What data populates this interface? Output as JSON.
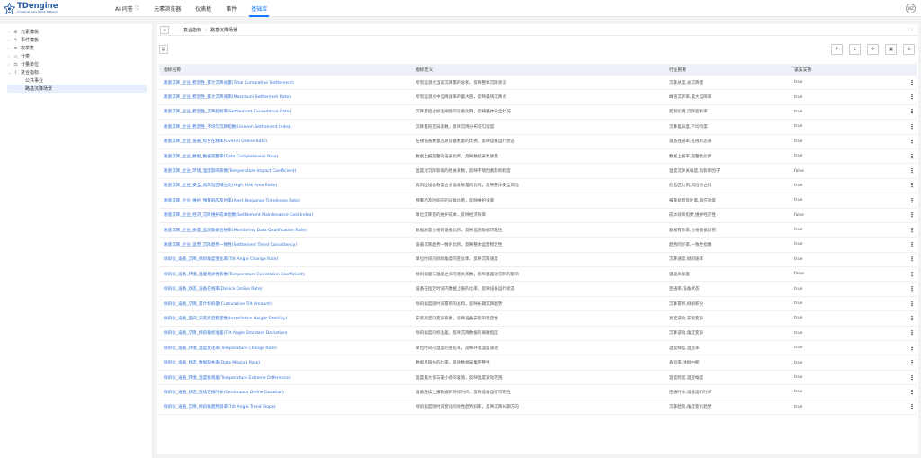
{
  "header": {
    "logo_name": "TDengine",
    "logo_tagline": "Industrial Data Mgmt Platform",
    "nav": [
      {
        "label": "AI 问答"
      },
      {
        "label": "元素浏览器"
      },
      {
        "label": "仪表板"
      },
      {
        "label": "事件"
      },
      {
        "label": "基础库"
      }
    ],
    "active_nav": "基础库",
    "avatar_initials": "WZ"
  },
  "sidebar": {
    "items": [
      {
        "label": "元素模板",
        "icon": "element-template-icon"
      },
      {
        "label": "事件模板",
        "icon": "event-template-icon"
      },
      {
        "label": "枚举集",
        "icon": "enum-icon"
      },
      {
        "label": "分类",
        "icon": "category-icon"
      },
      {
        "label": "计量单位",
        "icon": "unit-icon"
      },
      {
        "label": "复合指标",
        "icon": "composite-icon"
      }
    ],
    "children": [
      {
        "label": "公共事业"
      },
      {
        "label": "路基沉降场景"
      }
    ],
    "selected": "路基沉降场景"
  },
  "breadcrumb": {
    "parent": "复合指标",
    "current": "路基沉降场景"
  },
  "table": {
    "columns": [
      "指标名称",
      "指标定义",
      "行业别称",
      "该法支持"
    ],
    "rows": [
      [
        "路基沉降_企业_稳定性_累计沉降总量(Total Cumulative Settlement)",
        "所有监测点当前沉降量的总和，反映整体沉降状况",
        "沉降总量,总沉降量",
        "true"
      ],
      [
        "路基沉降_企业_稳定性_最大沉降速率(Maximum Settlement Rate)",
        "所有监测点中沉降速率的最大值，反映最快沉降点",
        "峰值沉降率,最大沉降率",
        "true"
      ],
      [
        "路基沉降_企业_稳定性_沉降超标率(Settlement Exceedance Rate)",
        "沉降量超过标准阈值的设备比例，反映整体安全状况",
        "超限比例,沉降超标率",
        "true"
      ],
      [
        "路基沉降_企业_稳定性_不均匀沉降指数(Uneven Settlement Index)",
        "沉降量的变异系数，反映沉降分布均匀程度",
        "沉降差异度,不均匀度",
        "true"
      ],
      [
        "路基沉降_企业_设备_综合在线率(Overall Online Rate)",
        "在线设备数量占总设备数量的比例，反映设备运行状态",
        "设备连通率,在线状态率",
        "true"
      ],
      [
        "路基沉降_企业_数据_数据完整率(Data Completeness Rate)",
        "数据上报完整的设备比例，反映数据采集质量",
        "数据上报率,完整性比例",
        "true"
      ],
      [
        "路基沉降_企业_环境_温度影响系数(Temperature Impact Coefficient)",
        "温度对沉降影响的相关系数，反映环境因素影响程度",
        "温度沉降关联度,热影响因子",
        "false"
      ],
      [
        "路基沉降_企业_安全_高风险区域占比(High Risk Area Ratio)",
        "高风险设备数量占总设备数量的比例，反映整体安全风险",
        "危险区比例,风险点占比",
        "true"
      ],
      [
        "路基沉降_企业_维护_预警响应及时率(Alert Response Timeliness Rate)",
        "预警后及时响应的设备比例，反映维护效率",
        "报警处理及时率,响应效率",
        "true"
      ],
      [
        "路基沉降_企业_经济_沉降维护成本指数(Settlement Maintenance Cost Index)",
        "单位沉降量的维护成本，反映经济效率",
        "成本效率指数,维护经济性",
        "false"
      ],
      [
        "路基沉降_企业_质量_监测数据合格率(Monitoring Data Qualification Rate)",
        "数据质量合格的设备比例，反映监测数据可靠性",
        "数据有效率,合格数据比例",
        "true"
      ],
      [
        "路基沉降_企业_运营_沉降趋势一致性(Settlement Trend Consistency)",
        "设备沉降趋势一致的比例，反映整体运营稳定性",
        "趋势同步率,一致性指数",
        "true"
      ],
      [
        "倾斜仪_设备_沉降_倾斜角度变化率(Tilt Angle Change Rate)",
        "单位时间内倾斜角度的变化率，反映沉降速度",
        "沉降速度,倾斜速率",
        "true"
      ],
      [
        "倾斜仪_设备_环境_温度相关性系数(Temperature Correlation Coefficient)",
        "倾斜角度与温度之间的相关系数，反映温度对沉降的影响",
        "温度关联度",
        "false"
      ],
      [
        "倾斜仪_设备_状态_设备在线率(Device Online Rate)",
        "设备在指定时间内数据上报的比率，反映设备运行状态",
        "连通率,设备状态",
        "true"
      ],
      [
        "倾斜仪_设备_沉降_累计倾斜量(Cumulative Tilt Amount)",
        "倾斜角度随时间累积的总和，反映长期沉降趋势",
        "沉降累积,倾斜积分",
        "true"
      ],
      [
        "倾斜仪_设备_空间_安装高度稳定性(Installation Height Stability)",
        "安装高度的变异系数，反映设备安装的稳定性",
        "高度波动,安装变异",
        "true"
      ],
      [
        "倾斜仪_设备_沉降_倾斜角标准差(Tilt Angle Standard Deviation)",
        "倾斜角度的标准差，反映沉降数据的离散程度",
        "沉降波动,角度变异",
        "true"
      ],
      [
        "倾斜仪_设备_环境_温度变化率(Temperature Change Rate)",
        "单位时间内温度的变化率，反映环境温度波动",
        "温度梯度,温变率",
        "true"
      ],
      [
        "倾斜仪_设备_状态_数据缺失率(Data Missing Rate)",
        "数据点缺失的比率，反映数据采集完整性",
        "丢包率,数据中断",
        "true"
      ],
      [
        "倾斜仪_设备_环境_温度极值差(Temperature Extreme Difference)",
        "温度最大值与最小值的差值，反映温度波动范围",
        "温度跨度,温变幅度",
        "true"
      ],
      [
        "倾斜仪_设备_状态_连续在线时长(Continuous Online Duration)",
        "设备连续上报数据的持续时间，反映设备运行可靠性",
        "连通时长,设备运行时间",
        "true"
      ],
      [
        "倾斜仪_设备_沉降_倾斜角趋势斜率(Tilt Angle Trend Slope)",
        "倾斜角度随时间变化的线性趋势斜率，反映沉降长期方向",
        "沉降趋势,角度变化趋势",
        "true"
      ]
    ]
  }
}
